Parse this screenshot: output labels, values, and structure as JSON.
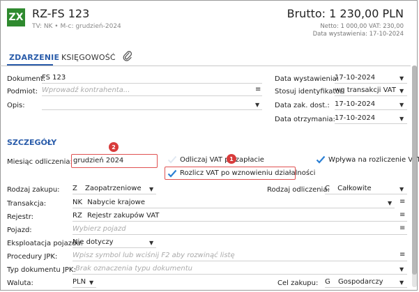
{
  "header": {
    "logo": "ZX",
    "title": "RZ-FS 123",
    "subtitle": "TV: NK  •  M-c: grudzień-2024",
    "brutto": "Brutto: 1 230,00 PLN",
    "netto_vat": "Netto: 1 000,00 VAT: 230,00",
    "issue_date": "Data wystawienia: 17-10-2024"
  },
  "tabs": [
    {
      "label": "ZDARZENIE",
      "active": true
    },
    {
      "label": "KSIĘGOWOŚĆ",
      "active": false
    }
  ],
  "icons": {
    "attachment": "paperclip-icon",
    "menu": "hamburger-icon",
    "dropdown": "chevron-down-icon",
    "checked": "checkmark-icon"
  },
  "form": {
    "dokument_label": "Dokument:",
    "dokument_value": "FS 123",
    "podmiot_label": "Podmiot:",
    "podmiot_placeholder": "Wprowadź kontrahenta...",
    "opis_label": "Opis:",
    "data_wystawienia_label": "Data wystawienia:",
    "data_wystawienia_value": "17-10-2024",
    "stosuj_label": "Stosuj identyfikator:",
    "stosuj_value": "wg transakcji VAT",
    "data_zak_label": "Data zak. dost.:",
    "data_zak_value": "17-10-2024",
    "data_otrz_label": "Data otrzymania:",
    "data_otrz_value": "17-10-2024"
  },
  "details": {
    "section_title": "SZCZEGÓŁY",
    "miesiac_label": "Miesiąc odliczenia:",
    "miesiac_value": "grudzień 2024",
    "odliczaj_label": "Odliczaj VAT po zapłacie",
    "odliczaj_checked": false,
    "wplywa_label": "Wpływa na rozliczenie VAT",
    "wplywa_checked": true,
    "rozlicz_label": "Rozlicz VAT po wznowieniu działalności",
    "rozlicz_checked": true,
    "badge1": "1",
    "badge2": "2",
    "rodzaj_zakupu_label": "Rodzaj zakupu:",
    "rodzaj_zakupu_code": "Z",
    "rodzaj_zakupu_value": "Zaopatrzeniowe",
    "rodzaj_odliczenia_label": "Rodzaj odliczenia:",
    "rodzaj_odliczenia_code": "C",
    "rodzaj_odliczenia_value": "Całkowite",
    "transakcja_label": "Transakcja:",
    "transakcja_code": "NK",
    "transakcja_value": "Nabycie krajowe",
    "rejestr_label": "Rejestr:",
    "rejestr_code": "RZ",
    "rejestr_value": "Rejestr zakupów VAT",
    "pojazd_label": "Pojazd:",
    "pojazd_placeholder": "Wybierz pojazd",
    "eksploatacja_label": "Eksploatacja pojazdu:",
    "eksploatacja_value": "Nie dotyczy",
    "procedury_label": "Procedury JPK:",
    "procedury_placeholder": "Wpisz symbol lub wciśnij F2 aby rozwinąć listę",
    "typ_label": "Typ dokumentu JPK:",
    "typ_placeholder": "Brak oznaczenia typu dokumentu",
    "waluta_label": "Waluta:",
    "waluta_value": "PLN",
    "cel_label": "Cel zakupu:",
    "cel_code": "G",
    "cel_value": "Gospodarczy"
  },
  "colors": {
    "accent": "#2a5caa",
    "logo_bg": "#2f8a2f",
    "highlight": "#e05050",
    "check": "#2a7fd4"
  }
}
